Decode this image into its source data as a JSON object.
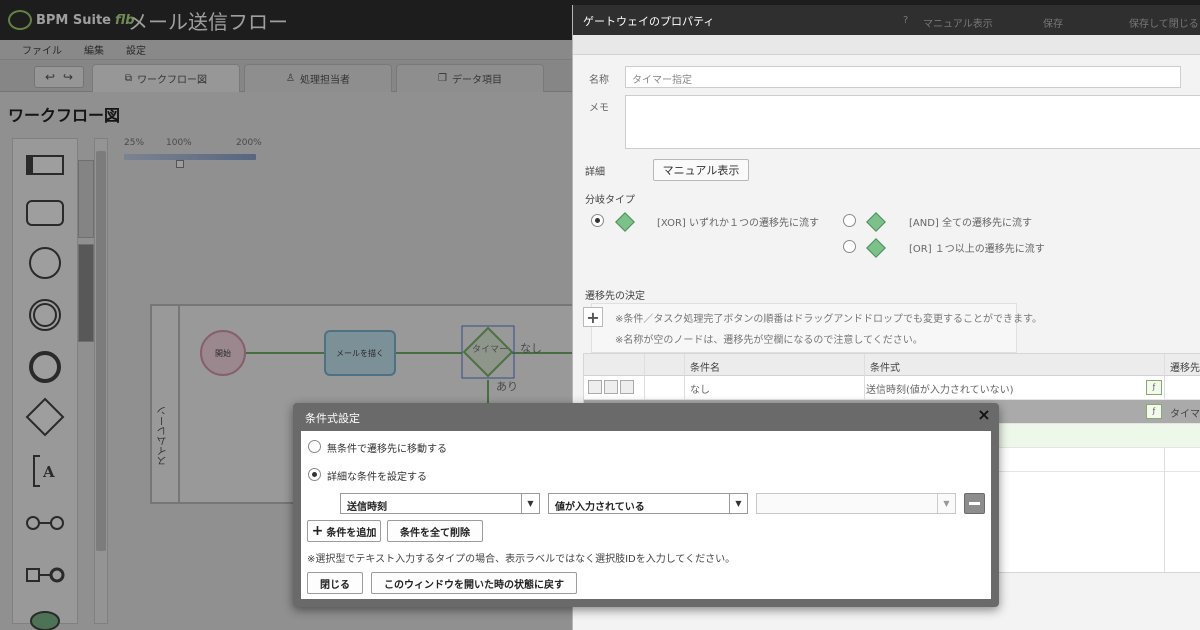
{
  "app": {
    "brand": "BPM Suite",
    "version": "flb",
    "title": "メール送信フロー",
    "menu": [
      "ファイル",
      "編集",
      "設定"
    ],
    "tabs": [
      "ワークフロー図",
      "処理担当者",
      "データ項目"
    ],
    "canvas_title": "ワークフロー図",
    "zoom_levels": [
      "25%",
      "100%",
      "200%"
    ],
    "lane_label": "スイムレーン",
    "nodes": {
      "start": "開始",
      "task": "メールを描く",
      "gateway": "タイマー",
      "branch_none": "なし",
      "branch_yes": "あり"
    }
  },
  "props": {
    "title": "ゲートウェイのプロパティ",
    "header_right": [
      "マニュアル表示",
      "保存",
      "保存して閉じる"
    ],
    "name_label": "名称",
    "name_value": "タイマー指定",
    "memo_label": "メモ",
    "detail_label": "詳細",
    "manual_button": "マニュアル表示",
    "branch_type_label": "分岐タイプ",
    "branch_options": [
      {
        "text": "[XOR] いずれか１つの遷移先に流す",
        "selected": true
      },
      {
        "text": "[AND] 全ての遷移先に流す",
        "selected": false
      },
      {
        "text": "[OR] １つ以上の遷移先に流す",
        "selected": false
      }
    ],
    "destination_label": "遷移先の決定",
    "notes": [
      "※条件／タスク処理完了ボタンの順番はドラッグアンドドロップでも変更することができます。",
      "※名称が空のノードは、遷移先が空欄になるので注意してください。"
    ],
    "grid": {
      "headers": [
        "条件名",
        "条件式",
        "遷移先"
      ],
      "rows": [
        {
          "name": "なし",
          "expression": "送信時刻(値が入力されていない)",
          "target": ""
        },
        {
          "name": "",
          "expression": "",
          "target": "タイマ"
        },
        {
          "name": "",
          "expression": "",
          "target": ""
        }
      ]
    }
  },
  "dialog": {
    "title": "条件式設定",
    "close": "×",
    "option_unconditional": "無条件で遷移先に移動する",
    "option_detailed": "詳細な条件を設定する",
    "selected_option": "detailed",
    "field_select": "送信時刻",
    "operator_select": "値が入力されている",
    "value_select": "",
    "add_condition": "条件を追加",
    "delete_all": "条件を全て削除",
    "note": "※選択型でテキスト入力するタイプの場合、表示ラベルではなく選択肢IDを入力してください。",
    "close_button": "閉じる",
    "reset_button": "このウィンドウを開いた時の状態に戻す"
  }
}
